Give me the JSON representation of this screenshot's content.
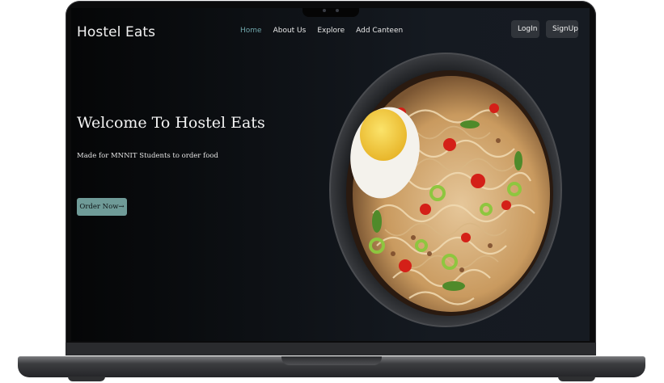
{
  "header": {
    "brand": "Hostel Eats",
    "nav_items": [
      {
        "label": "Home",
        "active": true
      },
      {
        "label": "About Us",
        "active": false
      },
      {
        "label": "Explore",
        "active": false
      },
      {
        "label": "Add Canteen",
        "active": false
      }
    ],
    "login_label": "LogIn",
    "signup_label": "SignUp"
  },
  "hero": {
    "title": "Welcome To Hostel Eats",
    "subtitle": "Made for MNNIT Students to order food",
    "cta_label": "Order Now→",
    "image_icon": "noodle-bowl-with-egg"
  },
  "colors": {
    "accent": "#6fa5aa",
    "cta_bg": "#6f9b98",
    "button_bg": "#30343a",
    "screen_bg": "#0d1014"
  }
}
